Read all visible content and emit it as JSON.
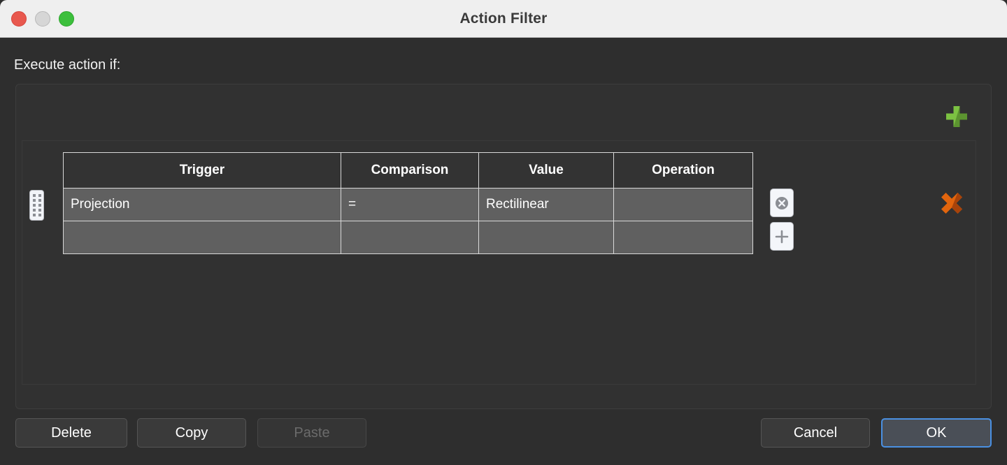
{
  "window": {
    "title": "Action Filter",
    "traffic_lights": [
      {
        "name": "close",
        "color": "#e8584e"
      },
      {
        "name": "minimize",
        "color": "#d6d6d6"
      },
      {
        "name": "zoom",
        "color": "#3cbf3c"
      }
    ]
  },
  "content": {
    "execute_label": "Execute action if:",
    "add_group_icon": "green-plus-icon",
    "remove_group_icon": "red-x-icon",
    "accent_green": "#6aac35",
    "accent_orange": "#e2650d"
  },
  "table": {
    "columns": [
      "Trigger",
      "Comparison",
      "Value",
      "Operation"
    ],
    "rows": [
      {
        "trigger": "Projection",
        "comparison": "=",
        "value": "Rectilinear",
        "operation": ""
      },
      {
        "trigger": "",
        "comparison": "",
        "value": "",
        "operation": ""
      }
    ],
    "row_remove_icon": "circle-x-icon",
    "row_add_icon": "plus-icon",
    "drag_handle_icon": "drag-handle-icon"
  },
  "footer": {
    "delete_label": "Delete",
    "copy_label": "Copy",
    "paste_label": "Paste",
    "cancel_label": "Cancel",
    "ok_label": "OK"
  }
}
